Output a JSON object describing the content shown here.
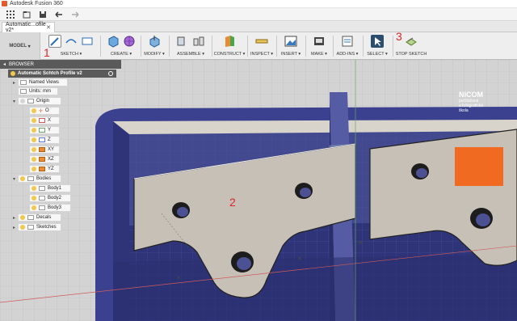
{
  "window": {
    "title": "Autodesk Fusion 360"
  },
  "doc_tab": {
    "label": "Automatic...ofile v2*"
  },
  "toolbar": {
    "model_label": "MODEL",
    "groups": [
      {
        "label": "SKETCH"
      },
      {
        "label": "CREATE"
      },
      {
        "label": "MODIFY"
      },
      {
        "label": "ASSEMBLE"
      },
      {
        "label": "CONSTRUCT"
      },
      {
        "label": "INSPECT"
      },
      {
        "label": "INSERT"
      },
      {
        "label": "MAKE"
      },
      {
        "label": "ADD-INS"
      },
      {
        "label": "SELECT"
      },
      {
        "label": "STOP SKETCH"
      }
    ]
  },
  "annotations": {
    "one": "1",
    "two": "2",
    "three": "3"
  },
  "browser": {
    "header": "BROWSER",
    "root": "Automatic Schtch Profile v2",
    "named_views": "Named Views",
    "units": "Units: mm",
    "origin": "Origin",
    "origin_items": [
      "O",
      "X",
      "Y",
      "Z",
      "XY",
      "XZ",
      "YZ"
    ],
    "bodies": "Bodies",
    "body_items": [
      "Body1",
      "Body2",
      "Body3"
    ],
    "decals": "Decals",
    "sketches": "Sketches"
  },
  "viewport": {
    "logo_title": "NICOM",
    "logo_line1": "počítačová",
    "logo_line2": "a fotografická",
    "logo_line3": "škola"
  },
  "colors": {
    "accent": "#0696d7",
    "box_blue": "#3a3f8f",
    "plate": "#c6bfb4",
    "annotation_red": "#e0242c",
    "logo_orange": "#f06a22"
  }
}
